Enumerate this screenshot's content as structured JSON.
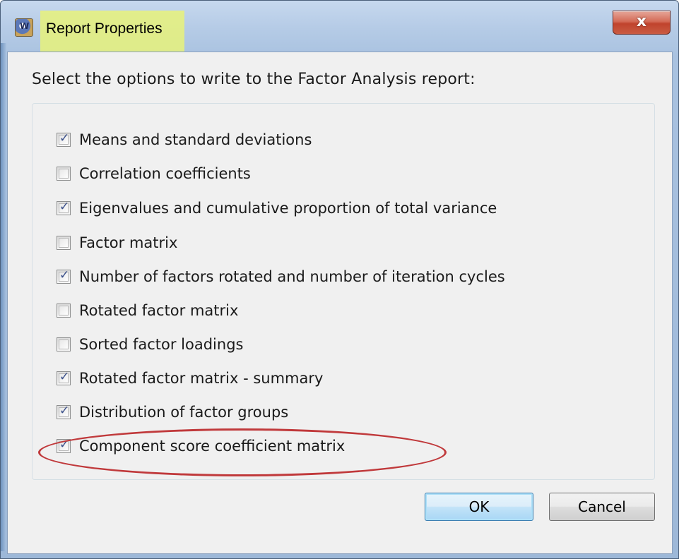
{
  "window": {
    "title": "Report Properties",
    "close_glyph": "x"
  },
  "dialog": {
    "instruction": "Select the options to write to the Factor Analysis report:",
    "options": [
      {
        "label": "Means and standard deviations",
        "checked": true
      },
      {
        "label": "Correlation coefficients",
        "checked": false
      },
      {
        "label": "Eigenvalues and cumulative proportion of total variance",
        "checked": true
      },
      {
        "label": "Factor matrix",
        "checked": false
      },
      {
        "label": "Number of factors rotated and number of iteration cycles",
        "checked": true
      },
      {
        "label": "Rotated factor matrix",
        "checked": false
      },
      {
        "label": "Sorted factor loadings",
        "checked": false
      },
      {
        "label": "Rotated factor matrix - summary",
        "checked": true
      },
      {
        "label": "Distribution of factor groups",
        "checked": true
      },
      {
        "label": "Component score coefficient matrix",
        "checked": true
      }
    ],
    "ok_label": "OK",
    "cancel_label": "Cancel"
  },
  "annotations": {
    "title_highlight_color": "#e8f27a",
    "ellipse_color": "#c0393b",
    "ellipse_target": "Component score coefficient matrix"
  },
  "icons": {
    "app": "app-icon",
    "close": "close-icon",
    "check": "checkmark-icon"
  }
}
